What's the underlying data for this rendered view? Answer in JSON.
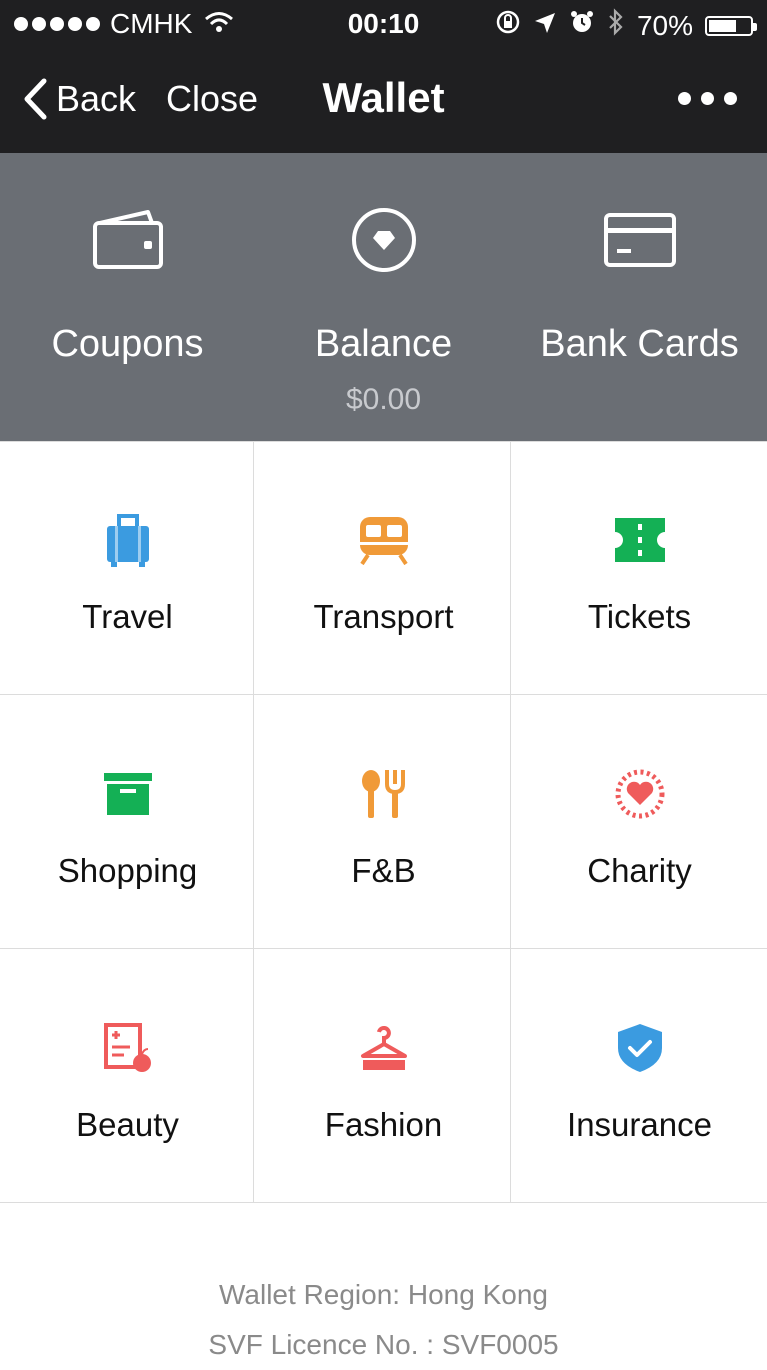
{
  "status_bar": {
    "carrier": "CMHK",
    "time": "00:10",
    "battery": "70%",
    "battery_level": 0.7
  },
  "nav": {
    "back_label": "Back",
    "close_label": "Close",
    "title": "Wallet"
  },
  "summary": {
    "items": [
      {
        "label": "Coupons",
        "icon": "wallet-icon"
      },
      {
        "label": "Balance",
        "sub": "$0.00",
        "icon": "balance-icon"
      },
      {
        "label": "Bank Cards",
        "icon": "card-icon"
      }
    ]
  },
  "services": [
    {
      "label": "Travel",
      "icon": "luggage-icon",
      "color": "#3b9be0"
    },
    {
      "label": "Transport",
      "icon": "train-icon",
      "color": "#f09a38"
    },
    {
      "label": "Tickets",
      "icon": "ticket-icon",
      "color": "#14b055"
    },
    {
      "label": "Shopping",
      "icon": "box-icon",
      "color": "#14b055"
    },
    {
      "label": "F&B",
      "icon": "cutlery-icon",
      "color": "#f09a38"
    },
    {
      "label": "Charity",
      "icon": "heart-icon",
      "color": "#ef5b5b"
    },
    {
      "label": "Beauty",
      "icon": "beauty-icon",
      "color": "#ef5b5b"
    },
    {
      "label": "Fashion",
      "icon": "hanger-icon",
      "color": "#ef5b5b"
    },
    {
      "label": "Insurance",
      "icon": "shield-icon",
      "color": "#3b9be0"
    }
  ],
  "footer": {
    "region": "Wallet Region: Hong Kong",
    "licence": "SVF Licence No. : SVF0005"
  }
}
